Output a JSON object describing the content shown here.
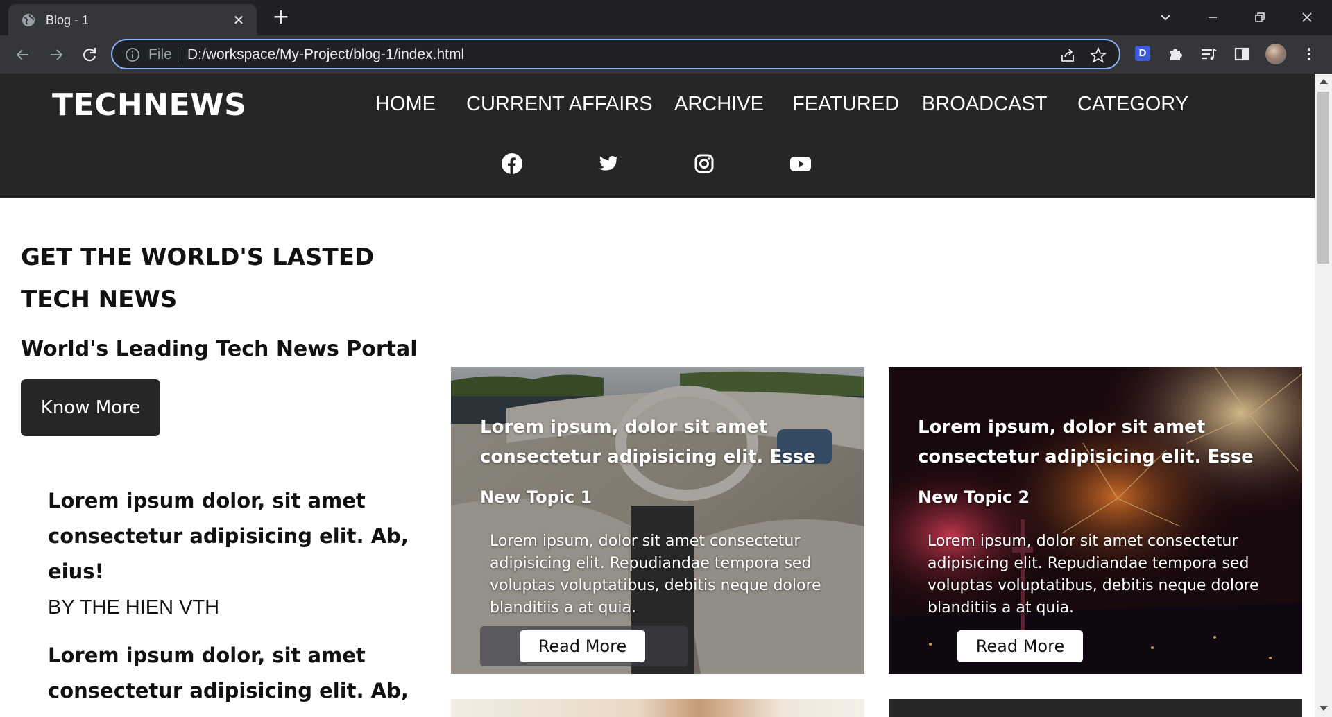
{
  "browser": {
    "tab_title": "Blog - 1",
    "address_label": "File",
    "address_url": "D:/workspace/My-Project/blog-1/index.html",
    "extension_letter": "D"
  },
  "site": {
    "logo": "TECHNEWS",
    "nav": [
      {
        "label": "HOME"
      },
      {
        "label": "CURRENT AFFAIRS"
      },
      {
        "label": "ARCHIVE"
      },
      {
        "label": "FEATURED"
      },
      {
        "label": "BROADCAST"
      },
      {
        "label": "CATEGORY"
      }
    ],
    "social_icons": [
      "facebook-icon",
      "twitter-icon",
      "instagram-icon",
      "youtube-icon"
    ]
  },
  "hero": {
    "title": "GET THE WORLD'S LASTED TECH NEWS",
    "subtitle": "World's Leading Tech News Portal",
    "button": "Know More"
  },
  "side_posts": [
    {
      "title": "Lorem ipsum dolor, sit amet consectetur adipisicing elit. Ab, eius!",
      "author": "BY THE HIEN VTH"
    },
    {
      "title": "Lorem ipsum dolor, sit amet consectetur adipisicing elit. Ab,"
    }
  ],
  "cards": [
    {
      "title": "Lorem ipsum, dolor sit amet consectetur adipisicing elit. Esse",
      "topic": "New Topic 1",
      "body": "Lorem ipsum, dolor sit amet consectetur adipisicing elit. Repudiandae tempora sed voluptas voluptatibus, debitis neque dolore blanditiis a at quia.",
      "button": "Read More"
    },
    {
      "title": "Lorem ipsum, dolor sit amet consectetur adipisicing elit. Esse",
      "topic": "New Topic 2",
      "body": "Lorem ipsum, dolor sit amet consectetur adipisicing elit. Repudiandae tempora sed voluptas voluptatibus, debitis neque dolore blanditiis a at quia.",
      "button": "Read More"
    }
  ],
  "colors": {
    "header_bg": "#262626",
    "button_dark": "#262626",
    "chrome_dark": "#202124",
    "chrome_toolbar": "#35363a",
    "omnibox_focus": "#8ab4f8"
  }
}
